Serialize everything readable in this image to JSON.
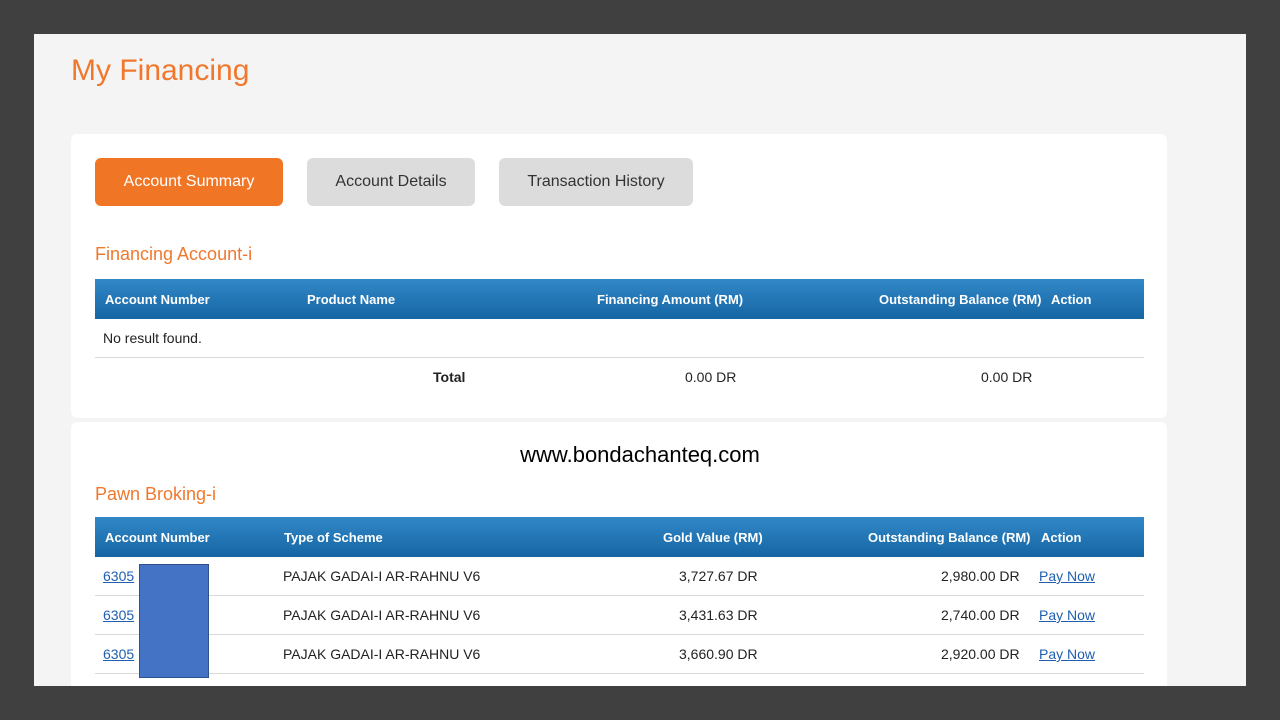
{
  "page": {
    "title": "My Financing"
  },
  "tabs": [
    {
      "label": "Account Summary",
      "active": true
    },
    {
      "label": "Account Details",
      "active": false
    },
    {
      "label": "Transaction History",
      "active": false
    }
  ],
  "financing": {
    "title": "Financing Account-i",
    "headers": {
      "account_number": "Account Number",
      "product_name": "Product Name",
      "financing_amount": "Financing Amount (RM)",
      "outstanding_balance": "Outstanding Balance (RM)",
      "action": "Action"
    },
    "empty_message": "No result found.",
    "total_label": "Total",
    "total_financing": "0.00 DR",
    "total_outstanding": "0.00 DR"
  },
  "watermark": "www.bondachanteq.com",
  "pawn": {
    "title": "Pawn Broking-i",
    "headers": {
      "account_number": "Account Number",
      "scheme": "Type of Scheme",
      "gold_value": "Gold Value (RM)",
      "outstanding_balance": "Outstanding Balance (RM)",
      "action": "Action"
    },
    "rows": [
      {
        "account": "6305",
        "scheme": "PAJAK GADAI-I AR-RAHNU V6",
        "gold_value": "3,727.67 DR",
        "outstanding": "2,980.00 DR",
        "action": "Pay Now"
      },
      {
        "account": "6305",
        "scheme": "PAJAK GADAI-I AR-RAHNU V6",
        "gold_value": "3,431.63 DR",
        "outstanding": "2,740.00 DR",
        "action": "Pay Now"
      },
      {
        "account": "6305",
        "scheme": "PAJAK GADAI-I AR-RAHNU V6",
        "gold_value": "3,660.90 DR",
        "outstanding": "2,920.00 DR",
        "action": "Pay Now"
      }
    ]
  },
  "colors": {
    "accent": "#f0782d",
    "header_blue": "#1f72b4",
    "redaction": "#4472c4"
  }
}
